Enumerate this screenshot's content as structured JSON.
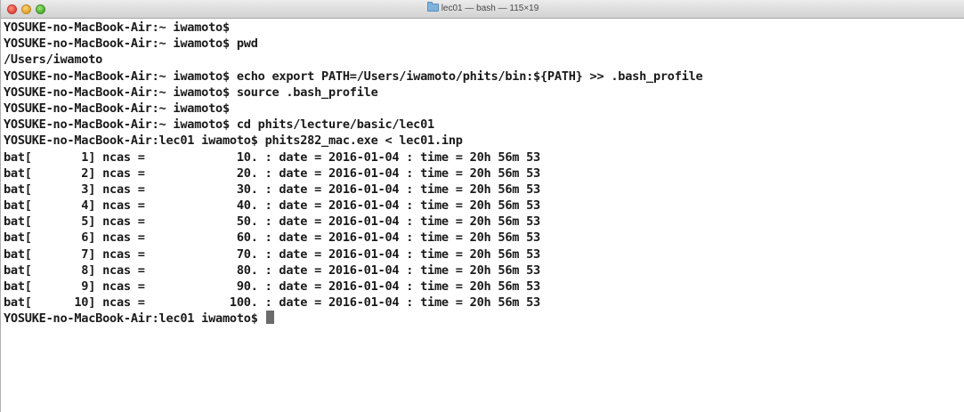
{
  "window": {
    "title": "lec01 — bash — 115×19"
  },
  "terminal": {
    "lines": [
      "YOSUKE-no-MacBook-Air:~ iwamoto$",
      "YOSUKE-no-MacBook-Air:~ iwamoto$ pwd",
      "/Users/iwamoto",
      "YOSUKE-no-MacBook-Air:~ iwamoto$ echo export PATH=/Users/iwamoto/phits/bin:${PATH} >> .bash_profile",
      "YOSUKE-no-MacBook-Air:~ iwamoto$ source .bash_profile",
      "YOSUKE-no-MacBook-Air:~ iwamoto$",
      "YOSUKE-no-MacBook-Air:~ iwamoto$ cd phits/lecture/basic/lec01",
      "YOSUKE-no-MacBook-Air:lec01 iwamoto$ phits282_mac.exe < lec01.inp",
      "bat[       1] ncas =             10. : date = 2016-01-04 : time = 20h 56m 53",
      "bat[       2] ncas =             20. : date = 2016-01-04 : time = 20h 56m 53",
      "bat[       3] ncas =             30. : date = 2016-01-04 : time = 20h 56m 53",
      "bat[       4] ncas =             40. : date = 2016-01-04 : time = 20h 56m 53",
      "bat[       5] ncas =             50. : date = 2016-01-04 : time = 20h 56m 53",
      "bat[       6] ncas =             60. : date = 2016-01-04 : time = 20h 56m 53",
      "bat[       7] ncas =             70. : date = 2016-01-04 : time = 20h 56m 53",
      "bat[       8] ncas =             80. : date = 2016-01-04 : time = 20h 56m 53",
      "bat[       9] ncas =             90. : date = 2016-01-04 : time = 20h 56m 53",
      "bat[      10] ncas =            100. : date = 2016-01-04 : time = 20h 56m 53"
    ],
    "current_prompt": "YOSUKE-no-MacBook-Air:lec01 iwamoto$ "
  },
  "colors": {
    "text": "#1a1a1a",
    "background": "#ffffff",
    "cursor": "#6b6b6b",
    "close_button": "#e0443a",
    "minimize_button": "#e0a12a",
    "zoom_button": "#4fae33"
  },
  "icons": {
    "title_icon": "folder-icon"
  }
}
